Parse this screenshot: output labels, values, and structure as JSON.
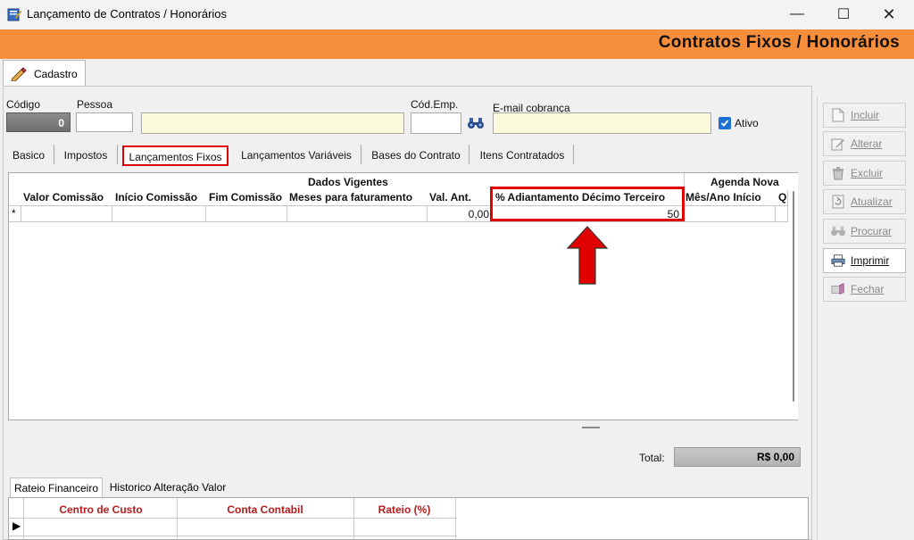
{
  "window": {
    "title": "Lançamento de Contratos / Honorários"
  },
  "header": {
    "title": "Contratos Fixos / Honorários"
  },
  "top_tab": {
    "label": "Cadastro"
  },
  "fields": {
    "codigo_label": "Código",
    "codigo_value": "0",
    "pessoa_label": "Pessoa",
    "pessoa_code": "",
    "pessoa_name": "",
    "cod_emp_label": "Cód.Emp.",
    "cod_emp_value": "",
    "email_label": "E-mail cobrança",
    "email_value": "",
    "ativo_label": "Ativo",
    "ativo_checked": true
  },
  "tabs": [
    {
      "label": "Basico"
    },
    {
      "label": "Impostos"
    },
    {
      "label": "Lançamentos Fixos"
    },
    {
      "label": "Lançamentos Variáveis"
    },
    {
      "label": "Bases do Contrato"
    },
    {
      "label": "Itens Contratados"
    }
  ],
  "active_tab": "Lançamentos Fixos",
  "grid": {
    "group_headers": [
      "Dados Vigentes",
      "Agenda Nova"
    ],
    "columns": [
      "Valor Comissão",
      "Início Comissão",
      "Fim Comissão",
      "Meses para faturamento",
      "Val. Ant.",
      "% Adiantamento Décimo Terceiro",
      "Mês/Ano Início",
      "Q"
    ],
    "new_row_marker": "*",
    "row": {
      "valor_comissao": "",
      "inicio_comissao": "",
      "fim_comissao": "",
      "meses_faturamento": "",
      "val_ant": "0,00",
      "adiantamento_decimo_terceiro": "50",
      "mes_ano_inicio": "",
      "q": ""
    }
  },
  "side_buttons": [
    {
      "label": "Incluir",
      "icon": "document-icon",
      "enabled": false
    },
    {
      "label": "Alterar",
      "icon": "edit-icon",
      "enabled": false
    },
    {
      "label": "Excluir",
      "icon": "trash-icon",
      "enabled": false
    },
    {
      "label": "Atualizar",
      "icon": "refresh-icon",
      "enabled": false
    },
    {
      "label": "Procurar",
      "icon": "binoculars-icon",
      "enabled": false
    },
    {
      "label": "Imprimir",
      "icon": "printer-icon",
      "enabled": true
    },
    {
      "label": "Fechar",
      "icon": "close-door-icon",
      "enabled": false
    }
  ],
  "total": {
    "label": "Total:",
    "value": "R$ 0,00"
  },
  "bottom_tabs": [
    {
      "label": "Rateio Financeiro"
    },
    {
      "label": "Historico Alteração Valor"
    }
  ],
  "bottom_grid": {
    "columns": [
      "Centro de Custo",
      "Conta Contabil",
      "Rateio (%)"
    ],
    "current_row_marker": "▶"
  },
  "colors": {
    "header_bg": "#f78e3b",
    "highlight": "#e00000",
    "bottom_header_text": "#b71b1b"
  }
}
